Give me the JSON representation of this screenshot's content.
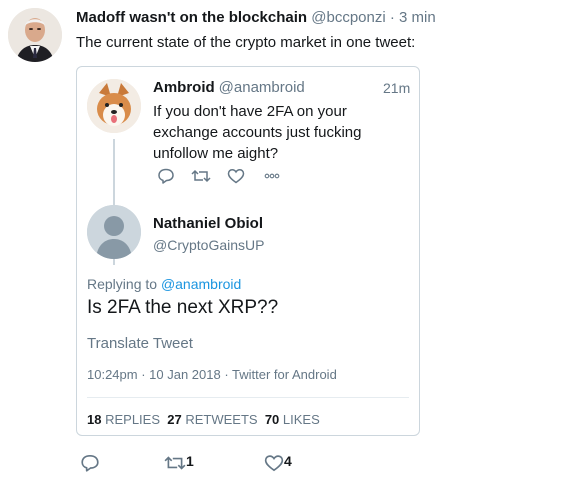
{
  "tweet": {
    "name": "Madoff wasn't on the blockchain",
    "handle": "@bccponzi",
    "dot": "·",
    "time": "3 min",
    "text": "The current state of the crypto market in one tweet:"
  },
  "card": {
    "quoted": {
      "name": "Ambroid",
      "handle": "@anambroid",
      "time": "21m",
      "text": "If you don't have 2FA on your exchange accounts just fucking unfollow me aight?"
    },
    "reply": {
      "name": "Nathaniel Obiol",
      "handle": "@CryptoGainsUP",
      "replying_prefix": "Replying to",
      "replying_handle": "@anambroid",
      "text": "Is 2FA the next XRP??",
      "translate": "Translate Tweet",
      "meta": "10:24pm · 10 Jan 2018 · Twitter for Android",
      "replies_count": "18",
      "replies_label": "REPLIES",
      "retweets_count": "27",
      "retweets_label": "RETWEETS",
      "likes_count": "70",
      "likes_label": "LIKES"
    }
  },
  "actions": {
    "retweet_count": "1",
    "like_count": "4"
  },
  "colors": {
    "link": "#1b95e0",
    "muted": "#657786",
    "border": "#ccd6dd"
  }
}
